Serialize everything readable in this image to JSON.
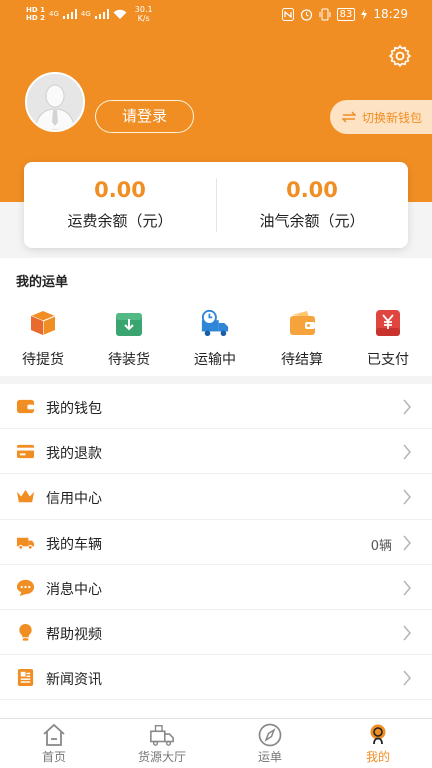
{
  "status_bar": {
    "hd1": "HD 1",
    "hd2": "HD 2",
    "net1": "4G",
    "net2": "4G",
    "speed_value": "30.1",
    "speed_unit": "K/s",
    "battery": "83",
    "time": "18:29"
  },
  "header": {
    "login_label": "请登录",
    "switch_wallet_label": "切换新钱包"
  },
  "balance": {
    "freight_value": "0.00",
    "freight_label": "运费余额（元）",
    "fuel_value": "0.00",
    "fuel_label": "油气余额（元）"
  },
  "waybill": {
    "title": "我的运单",
    "items": [
      {
        "label": "待提货",
        "icon": "box-icon"
      },
      {
        "label": "待装货",
        "icon": "download-box-icon"
      },
      {
        "label": "运输中",
        "icon": "truck-clock-icon"
      },
      {
        "label": "待结算",
        "icon": "wallet-icon"
      },
      {
        "label": "已支付",
        "icon": "yen-icon"
      }
    ]
  },
  "menu": {
    "items": [
      {
        "label": "我的钱包",
        "icon": "wallet-icon"
      },
      {
        "label": "我的退款",
        "icon": "refund-icon"
      },
      {
        "label": "信用中心",
        "icon": "crown-icon"
      },
      {
        "label": "我的车辆",
        "icon": "truck-icon",
        "value": "0辆"
      },
      {
        "label": "消息中心",
        "icon": "chat-icon"
      },
      {
        "label": "帮助视频",
        "icon": "lightbulb-icon"
      },
      {
        "label": "新闻资讯",
        "icon": "news-icon"
      }
    ]
  },
  "bottom_nav": {
    "items": [
      {
        "label": "首页",
        "icon": "home-icon"
      },
      {
        "label": "货源大厅",
        "icon": "cargo-truck-icon"
      },
      {
        "label": "运单",
        "icon": "compass-icon"
      },
      {
        "label": "我的",
        "icon": "profile-icon",
        "active": true
      }
    ]
  },
  "colors": {
    "accent": "#f08e24",
    "accent_light": "#fde2c3",
    "waybill_blue": "#2f86d6",
    "waybill_green": "#3aa570",
    "waybill_red": "#e0453f"
  }
}
